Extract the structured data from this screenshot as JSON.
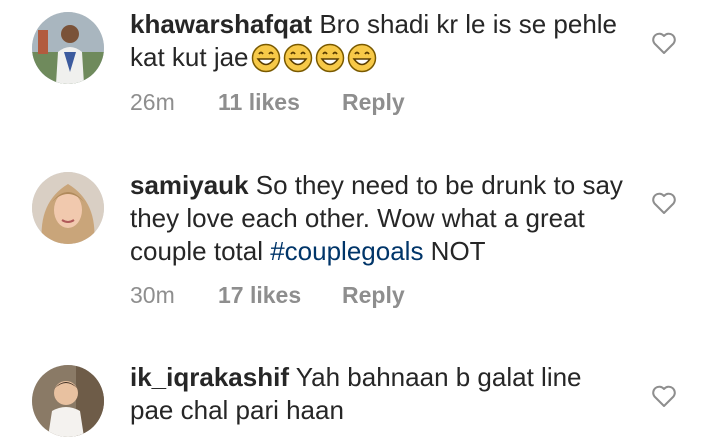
{
  "comments": [
    {
      "username": "khawarshafqat",
      "text": "Bro shadi kr le is se pehle kat kut jae",
      "emoji": [
        "grinning-face-emoji",
        "grinning-face-emoji",
        "grinning-face-emoji",
        "grinning-face-emoji"
      ],
      "time": "26m",
      "likes": "11 likes",
      "reply": "Reply",
      "avatar": "avatar-man-outdoors"
    },
    {
      "username": "samiyauk",
      "text_before": "So they need to be drunk to say they love each other. Wow what a great couple total ",
      "hashtag": "#couplegoals",
      "text_after": " NOT",
      "time": "30m",
      "likes": "17 likes",
      "reply": "Reply",
      "avatar": "avatar-woman"
    },
    {
      "username": "ik_iqrakashif",
      "text": "Yah bahnaan b galat line pae chal pari haan",
      "avatar": "avatar-child"
    }
  ],
  "icons": {
    "like": "heart-outline-icon"
  },
  "colors": {
    "text": "#262626",
    "meta": "#8e8e8e",
    "hashtag": "#003569",
    "emoji": "#f7c948"
  }
}
